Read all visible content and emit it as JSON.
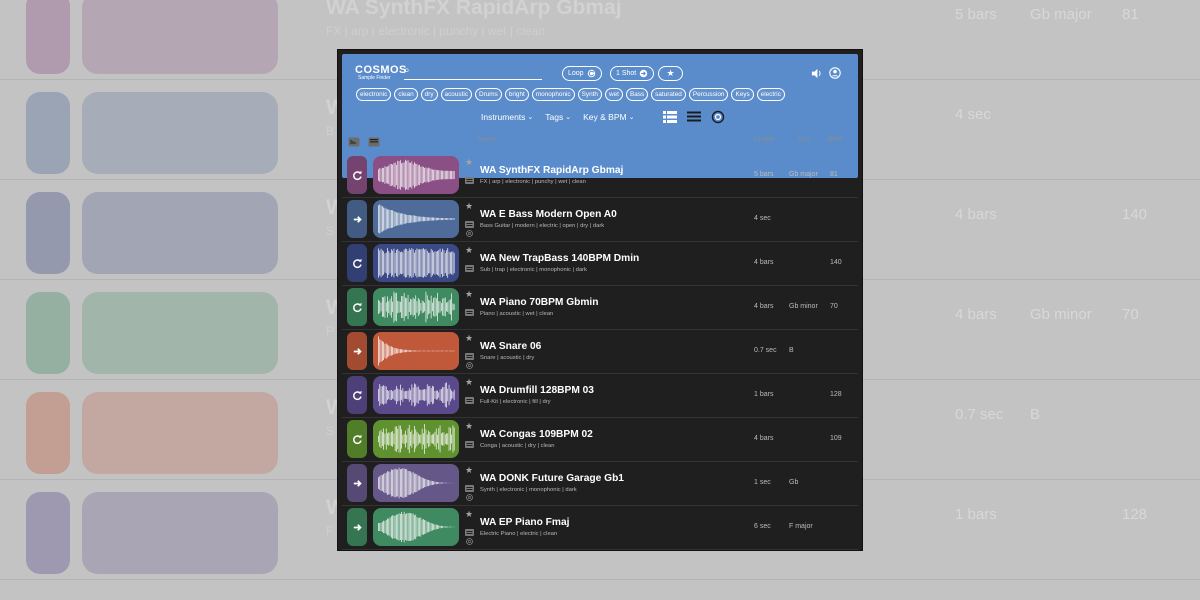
{
  "background": {
    "rows": [
      {
        "title": "WA SynthFX RapidArp Gbmaj",
        "tags": "FX | arp | electronic | punchy | wet | clean",
        "length": "5 bars",
        "key": "Gb major",
        "bpm": "81",
        "color": "#8a4f84",
        "mode": "loop"
      },
      {
        "title": "W",
        "tags": "B",
        "length": "4 sec",
        "key": "",
        "bpm": "",
        "color": "#4e6b9a",
        "mode": "oneshot"
      },
      {
        "title": "W",
        "tags": "S",
        "length": "4 bars",
        "key": "",
        "bpm": "140",
        "color": "#3b4a86",
        "mode": "loop"
      },
      {
        "title": "W",
        "tags": "P",
        "length": "4 bars",
        "key": "Gb minor",
        "bpm": "70",
        "color": "#3f8a60",
        "mode": "loop"
      },
      {
        "title": "W",
        "tags": "S",
        "length": "0.7 sec",
        "key": "B",
        "bpm": "",
        "color": "#c0583a",
        "mode": "oneshot"
      },
      {
        "title": "W",
        "tags": "F",
        "length": "1 bars",
        "key": "",
        "bpm": "128",
        "color": "#5a4a8c",
        "mode": "loop"
      }
    ]
  },
  "app": {
    "logo": "COSMOS",
    "logo_sub": "Sample Finder",
    "search_placeholder": "",
    "loop_label": "Loop",
    "oneshot_label": "1 Shot",
    "tags": [
      "electronic",
      "clean",
      "dry",
      "acoustic",
      "Drums",
      "bright",
      "monophonic",
      "Synth",
      "wet",
      "Bass",
      "saturated",
      "Percussion",
      "Keys",
      "electric"
    ],
    "filters": [
      "Instruments",
      "Tags",
      "Key & BPM"
    ],
    "columns": {
      "name": "Name",
      "length": "Length",
      "key": "Key",
      "bpm": "BPM"
    }
  },
  "samples": [
    {
      "title": "WA SynthFX RapidArp Gbmaj",
      "tags": "FX | arp | electronic | punchy | wet | clean",
      "length": "5 bars",
      "key": "Gb major",
      "bpm": "81",
      "color": "#8a4f84",
      "mode": "loop",
      "shape": "arp"
    },
    {
      "title": "WA E Bass Modern Open A0",
      "tags": "Bass Guitar | modern | electric | open | dry | dark",
      "length": "4 sec",
      "key": "",
      "bpm": "",
      "color": "#4e6b9a",
      "mode": "oneshot",
      "shape": "decay"
    },
    {
      "title": "WA New TrapBass 140BPM Dmin",
      "tags": "Sub | trap | electronic | monophonic | dark",
      "length": "4 bars",
      "key": "",
      "bpm": "140",
      "color": "#3b4a86",
      "mode": "loop",
      "shape": "dense"
    },
    {
      "title": "WA Piano 70BPM Gbmin",
      "tags": "Piano | acoustic | wet | clean",
      "length": "4 bars",
      "key": "Gb minor",
      "bpm": "70",
      "color": "#3f8a60",
      "mode": "loop",
      "shape": "piano"
    },
    {
      "title": "WA Snare 06",
      "tags": "Snare | acoustic | dry",
      "length": "0.7 sec",
      "key": "B",
      "bpm": "",
      "color": "#c0583a",
      "mode": "oneshot",
      "shape": "snare"
    },
    {
      "title": "WA Drumfill 128BPM 03",
      "tags": "Full-Kit | electronic | fill | dry",
      "length": "1 bars",
      "key": "",
      "bpm": "128",
      "color": "#5a4a8c",
      "mode": "loop",
      "shape": "fill"
    },
    {
      "title": "WA Congas 109BPM 02",
      "tags": "Conga | acoustic | dry | clean",
      "length": "4 bars",
      "key": "",
      "bpm": "109",
      "color": "#5f922f",
      "mode": "loop",
      "shape": "congas"
    },
    {
      "title": "WA DONK Future Garage Gb1",
      "tags": "Synth | electronic | monophonic | dark",
      "length": "1 sec",
      "key": "Gb",
      "bpm": "",
      "color": "#655788",
      "mode": "oneshot",
      "shape": "donk"
    },
    {
      "title": "WA EP Piano Fmaj",
      "tags": "Electric Piano | electric | clean",
      "length": "6 sec",
      "key": "F major",
      "bpm": "",
      "color": "#3f8a60",
      "mode": "oneshot",
      "shape": "ep"
    }
  ]
}
